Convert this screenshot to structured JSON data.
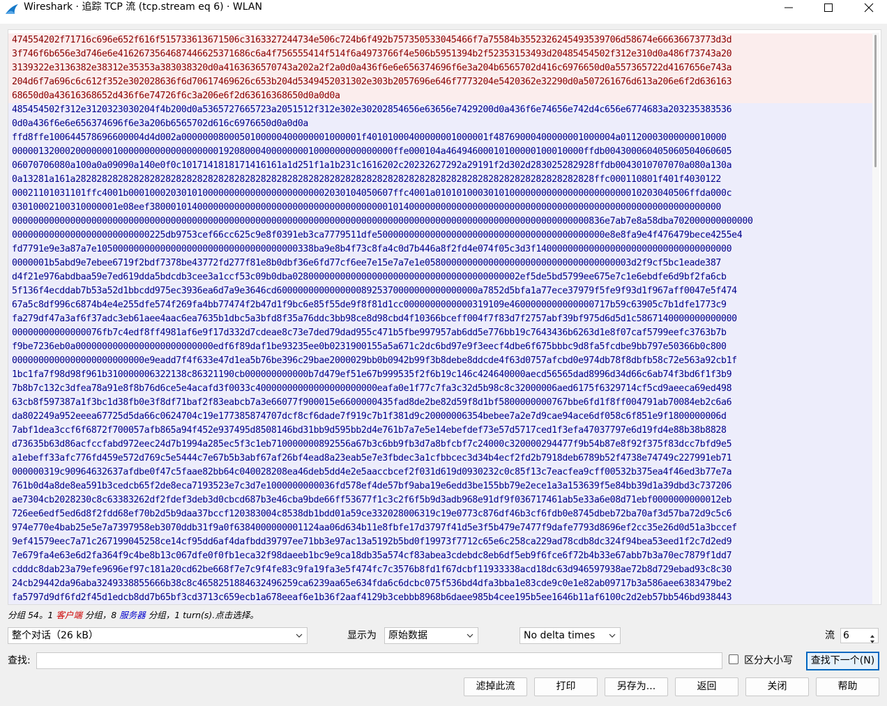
{
  "window": {
    "title": "Wireshark · 追踪 TCP 流 (tcp.stream eq 6) · WLAN"
  },
  "stream": {
    "client_lines": [
      "474554202f71716c696e652f616f515733613671506c3163327244734e506c724b6f492b757350533045466f7a75584b355232624549353970 6d58674e66636673773d3d",
      "3f746f6b656e3d746e6e41626735646874466253716 86c6a4f756555414f514f6a4973766f4e506b5951394b2f52353153493d20485454502f312e310d0a486f73743a20",
      "3139322e3136382e38312e35353a383038320d0a4163636570743a202a2f2a0d0a436f6e6e656374696f6e3a204b6565702d416c6976650d0a557365722d4167656e743a",
      "204d6f7a696c6c612f352e302028636f6d70617469626c653b204d5349452031302e303b2057696e646f7773204e5420362e32290d0a507261676d613a206e6f2d636163",
      "68650d0a43616368652d436f6e74726f6c3a206e6f2d63616368650d0a0d0a"
    ],
    "server_header_lines": [
      "485454502f312e3120323030204f4b200d0a5365727665723a2051512f312e302e30202854656e63656e7429200d0a436f6e74656e742d4c656e6774683a203235383536",
      "0d0a436f6e6e656374696f6e3a206b6565702d616c6976650d0a0d0a"
    ],
    "server_body_lines": [
      "ffd8ffe100644578696600004d4d002a00000008000501000004000000010000 01f401010004000000010000 01f487690004000000010000 04a01120003000000010000",
      "0000013200020000000100000000000000000001920800040000000010000000 00000000ffe000104a46494600010100000100010000ffdb004300060405060504060605",
      "06070706080a100a0a09090a140e0f0c1017141818171416161a1d251f1a1b231c1616202c20232627292a29191f2d302d283025282928ffdb0043010707070a080a130a",
      "0a13281a161a28282828282828282828282828282828282828282828282828282828282828282828282828282828282828282828282828ffc0001108 01f401f4030122",
      "00021101031101ffc4001b000100020301010000000000000000000000020301040 50607ffc4001a01010100030101000000000000000000000001020304050 6ffda000c",
      "0301000210031000000 1e08eef380001014000000000000000000000000000000000000101400000000000000000000000000000000000000000000000000000000000",
      "0000000000000000000000000000000000000000000000000000000000000000000000000000000000000000000000000000000000000836e7ab7e8a58dba702000000000000",
      "00000000000000000000000000225db9753cef66cc625c9e8f0391eb3ca7779511dfe5000000000000000000000000000000000000000000e8e8fa9e4f476479bece4255e4",
      "fd7791e9e3a87a7e10500000000000000000000000000000000000338ba9e8b4f73c8fa4c0d7b446a8f2fd4e074f05c3d3f1400000000000000000000000000000000000",
      "0000001b5abd9e7ebee6719f2bdf7378be43772fd277f81e8b0dbf36e6fd77cf6ee7e15e7a7e1e058000000000000000000000000000000000003d2f9cf5bc1eade387",
      "d4f21e976abdbaa59e7ed619dda5bdcdb3cee3a1ccf53c09b0dba0280000000000000000000000000000000000000002ef5de5bd5799ee675e7c1e6ebdfe6d9bf2fa6cb",
      "5f136f4ecddab7b53a52d1bbcdd975ec3936ea6d7a9e3646cd60000000000000008925370000000000000000a7852d5bfa1a77ece37979f5fe9f93d1f967aff0047e5f474",
      "67a5c8df996c6874b4e4e255dfe574f269fa4bb77474f2b47d1f9bc6e85f55de9f8f81d1cc0000000000000319109e4600000000000000717b59c63905c7b1dfe1773c9",
      "fa279df47a3af6f37adc3eb61aee4aac6ea7635b1dbc5a3bfd8f35a76ddc3bb98ce8d98cbd4f10366bceff004f7f83d7f2757abf39bf975d6d5d1c5867140000000000000",
      "00000000000000076fb7c4edf8ff4981af6e9f17d332d7cdeae8c73e7ded79dad955c471b5fbe997957ab6dd5e776bb19c7643436b6263d1e8f07caf5799eefc3763b7b",
      "f9be7236eb0a00000000000000000000000000edf6f89daf1be93235ee0b0231900155a5a671c2dc6bd97e9f3eecf4dbe6f675bbbc9d8fa5fcdbe9bb797e50366b0c800",
      "0000000000000000000000000e9eadd7f4f633e47d1ea5b76be396c29bae2000029bb0b0942b99f3b8debe8ddcde4f63d0757afcbd0e974db78f8dbfb58c72e563a92cb1f",
      "1bc1fa7f98d98f961b310000006322138c86321190cb000000000000b7d479ef51e67b999535f2f6b19c146c424640000aecd56565dad8996d34d66c6ab74f3bd6f1f3b9",
      "7b8b7c132c3dfea78a91e8f8b76d6ce5e4acafd3f0033c40000000000000000000000eafa0e1f77c7fa3c32d5b98c8c32000006aed6175f6329714cf5cd9aeeca69ed498",
      "63cb8f597387a1f3bc1d38fb0e3f8df71baf2f83eabcb7a3e66077f900015e6600000435fad8de2be82d59f8d1bf5800000000767bbe6fd1f8ff004791ab70084eb2c6a6",
      "da802249a952eeea67725d5da66c0624704c19e177385874707dcf8cf6dade7f919c7b1f381d9c20000006354bebee7a2e7d9cae94ace6df058c6f851e9f1800000006d",
      "7abf1dea3ccf6f6872f700057afb865a94f452e937495d8508146bd31bb9d595bb2d4e761b7a7e5e14ebefdef73e57d5717ced1f3efa47037797e6d19fd4e88b38b8828",
      "d73635b63d86acfccfabd972eec24d7b1994a285ec5f3c1eb710000000892556a67b3c6bb9fb3d7a8bfcbf7c24000c320000294477f9b54b87e8f92f375f83dcc7bfd9e5",
      "a1ebeff33afc776fd459e572d769c5e5444c7e67b5b3abf67af26bf4ead8a23eab5e7e3fbdec3a1cfbbcec3d34b4ecf2fd2b7918deb6789b52f4738e74749c227991eb71",
      "000000319c90964632637afdbe0f47c5faae82bb64c040028208ea46deb5dd4e2e5aaccbcef2f031d619d0930232c0c85f13c7eacfea9cff00532b375ea4f46ed3b77e7a",
      "761b0d4a8de8ea591b3cedcb65f2de8eca7193523e7c3d7e1000000000036fd578ef4de57bf9aba19e6edd3be155bb79e2ece1a3a153639f5e84bb39d1a39dbd3c737206",
      "ae7304cb2028230c8c63383262df2fdef3deb3d0cbcd687b3e46cba9bde66ff53677f1c3c2f6f5b9d3adb968e91df9f036717461ab5e33a6e08d71ebf0000000000012eb",
      "726ee6edf5ed6d8f2fdd68ef70b2d5b9daa37bccf120383004c8538db1bdd01a59ce332028006319c19e0773c876df46b3cf6fdb0e8745dbeb72ba70af3d57ba72d9c5c6",
      "974e770e4bab25e5e7a7397958eb3070ddb31f9a0f6384000000001124aa06d634b11e8fbfe17d3797f41d5e3f5b479e7477f9dafe7793d8696ef2cc35e26d0d51a3bccef",
      "9ef41579eec7a71c267199045258ce14cf95dd6af4dafbdd39797ee71bb3e97ac13a5192b5bd0f19973f7712c65e6c258ca229ad78cdb8dc324f94bea53eed1f2c7d2ed9",
      "7e679fa4e63e6d2fa364f9c4be8b13c067dfe0f0fb1eca32f98daeeb1bc9e9ca18db35a574cf83abea3cdebdc8eb6df5eb9f6fce6f72b4b33e67abb7b3a70ec7879f1dd7",
      "cdddc8dab23a79efe9696ef97c181a20cd62be668f7e7c9f4fe83c9fa19fa3e5f474fc7c3576b8fd1f67dcbf11933338acd18dc63d946597938ae72b8d729ebad93c8c30",
      "24cb29442da96aba3249338855666b38c8c4658251884632496259ca6239aa65e634fda6c6dcbc075f536bd4dfa3bba1e83cde9c0e1e82ab09717b3a586aee6383479be2",
      "fa5797d9df6fd2f45d1edcb8dd7b65bf3cd3713c659ecb1a678eeaf6e1b36f2aaf4129b3cebbb8968b6daee985b4cee195b5ee1646b11af6100c2d2eb57bb546bd938443"
    ]
  },
  "status": {
    "prefix": "分组 54。1 ",
    "client_word": "客户端",
    "middle": " 分组，8 ",
    "server_word": "服务器",
    "suffix": " 分组，1 turn(s).点击选择。"
  },
  "controls": {
    "conversation_value": "整个对话（26 kB）",
    "format_label": "显示为",
    "format_value": "原始数据",
    "delta_value": "No delta times",
    "stream_label": "流",
    "stream_value": "6",
    "find_label": "查找:",
    "find_value": "",
    "case_label": "区分大小写",
    "find_next": "查找下一个(N)"
  },
  "buttons": {
    "filter_out": "滤掉此流",
    "print": "打印",
    "save_as": "另存为...",
    "back": "返回",
    "close": "关闭",
    "help": "帮助"
  },
  "colors": {
    "client_text": "#8b0000",
    "client_bg": "#fbeded",
    "server_text": "#00008b",
    "server_bg": "#ededfb",
    "accent": "#0067c0"
  }
}
